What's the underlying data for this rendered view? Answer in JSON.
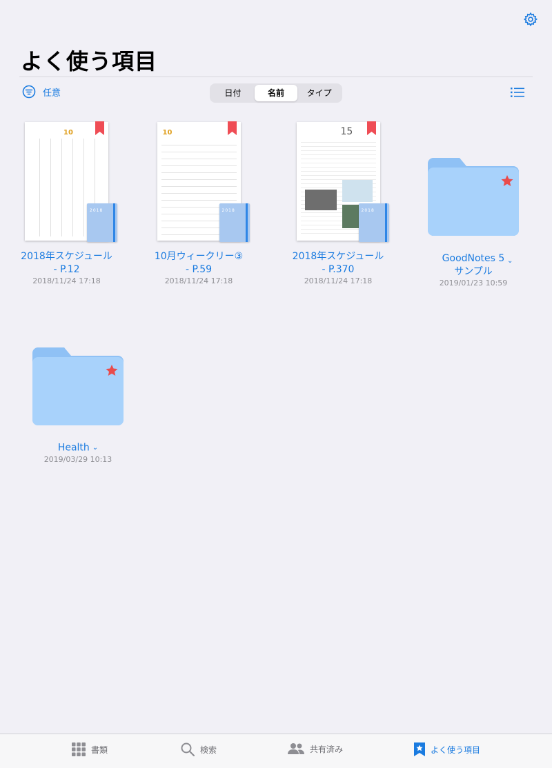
{
  "header": {
    "title": "よく使う項目"
  },
  "toolbar": {
    "sort_label": "任意",
    "segments": [
      {
        "label": "日付",
        "selected": false
      },
      {
        "label": "名前",
        "selected": true
      },
      {
        "label": "タイプ",
        "selected": false
      }
    ]
  },
  "items": [
    {
      "type": "notebook",
      "name_line1": "2018年スケジュール",
      "name_line2": "- P.12",
      "date": "2018/11/24 17:18",
      "cover_year": "2018",
      "page_day": "10"
    },
    {
      "type": "notebook",
      "name_line1": "10月ウィークリー③",
      "name_line2": "- P.59",
      "date": "2018/11/24 17:18",
      "cover_year": "2018",
      "page_day": "10"
    },
    {
      "type": "notebook",
      "name_line1": "2018年スケジュール",
      "name_line2": "- P.370",
      "date": "2018/11/24 17:18",
      "cover_year": "2018",
      "page_day": "15"
    },
    {
      "type": "folder",
      "name_line1": "GoodNotes 5",
      "name_line2": "サンプル",
      "date": "2019/01/23 10:59"
    },
    {
      "type": "folder",
      "name_line1": "Health",
      "date": "2019/03/29 10:13"
    }
  ],
  "tabs": [
    {
      "label": "書類",
      "icon": "grid-icon",
      "active": false
    },
    {
      "label": "検索",
      "icon": "search-icon",
      "active": false
    },
    {
      "label": "共有済み",
      "icon": "people-icon",
      "active": false
    },
    {
      "label": "よく使う項目",
      "icon": "star-bookmark-icon",
      "active": true
    }
  ],
  "colors": {
    "accent": "#1a7be0",
    "folder": "#a8d2fb",
    "star": "#e94b4b",
    "background": "#f1f0f6"
  }
}
